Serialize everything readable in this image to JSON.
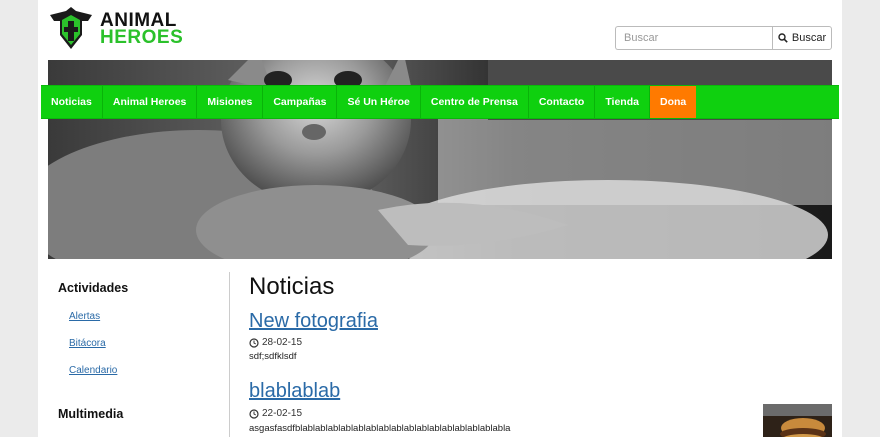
{
  "logo": {
    "line1": "ANIMAL",
    "line2": "HEROES"
  },
  "search": {
    "placeholder": "Buscar",
    "button_label": "Buscar"
  },
  "nav": {
    "items": [
      {
        "label": "Noticias"
      },
      {
        "label": "Animal Heroes"
      },
      {
        "label": "Misiones"
      },
      {
        "label": "Campañas"
      },
      {
        "label": "Sé Un Héroe"
      },
      {
        "label": "Centro de Prensa"
      },
      {
        "label": "Contacto"
      },
      {
        "label": "Tienda"
      },
      {
        "label": "Dona"
      }
    ]
  },
  "sidebar": {
    "section1_title": "Actividades",
    "section1_links": [
      {
        "label": "Alertas"
      },
      {
        "label": "Bitácora"
      },
      {
        "label": "Calendario"
      }
    ],
    "section2_title": "Multimedia"
  },
  "main": {
    "heading": "Noticias",
    "posts": [
      {
        "title": "New fotografia",
        "date": "28-02-15",
        "excerpt": "sdf;sdfklsdf"
      },
      {
        "title": "blablablab",
        "date": "22-02-15",
        "excerpt": "asgasfasdfblablablablablablablablablablablablablablablablabla"
      }
    ]
  },
  "colors": {
    "nav_green": "#0fd00f",
    "donate_orange": "#ff7a00",
    "link_blue": "#2a6aa7",
    "brand_green": "#2bc12b"
  }
}
